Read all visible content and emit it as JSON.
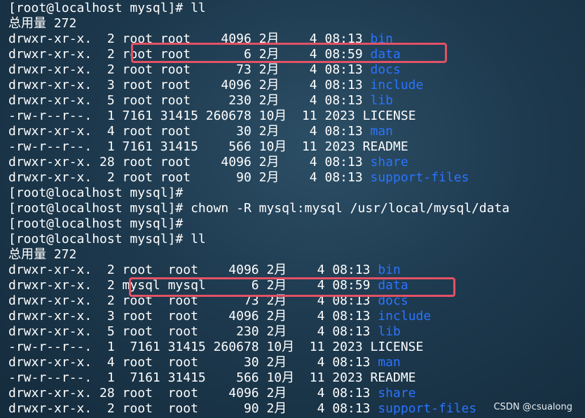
{
  "colors": {
    "directory": "#2a74ff",
    "text": "#ffffff",
    "highlight": "#e25264"
  },
  "block1": {
    "prompt": "[root@localhost mysql]# ll",
    "total": "总用量 272",
    "rows": [
      {
        "prefix": "drwxr-xr-x.  2 root root    4096 2月    4 08:13 ",
        "name": "bin",
        "is_dir": true
      },
      {
        "prefix": "drwxr-xr-x.  2 root root       6 2月    4 08:59 ",
        "name": "data",
        "is_dir": true,
        "highlighted": true
      },
      {
        "prefix": "drwxr-xr-x.  2 root root      73 2月    4 08:13 ",
        "name": "docs",
        "is_dir": true
      },
      {
        "prefix": "drwxr-xr-x.  3 root root    4096 2月    4 08:13 ",
        "name": "include",
        "is_dir": true
      },
      {
        "prefix": "drwxr-xr-x.  5 root root     230 2月    4 08:13 ",
        "name": "lib",
        "is_dir": true
      },
      {
        "prefix": "-rw-r--r--.  1 7161 31415 260678 10月  11 2023 ",
        "name": "LICENSE",
        "is_dir": false
      },
      {
        "prefix": "drwxr-xr-x.  4 root root      30 2月    4 08:13 ",
        "name": "man",
        "is_dir": true
      },
      {
        "prefix": "-rw-r--r--.  1 7161 31415    566 10月  11 2023 ",
        "name": "README",
        "is_dir": false
      },
      {
        "prefix": "drwxr-xr-x. 28 root root    4096 2月    4 08:13 ",
        "name": "share",
        "is_dir": true
      },
      {
        "prefix": "drwxr-xr-x.  2 root root      90 2月    4 08:13 ",
        "name": "support-files",
        "is_dir": true
      }
    ]
  },
  "middle_prompts": [
    "[root@localhost mysql]#",
    "[root@localhost mysql]# chown -R mysql:mysql /usr/local/mysql/data",
    "[root@localhost mysql]#"
  ],
  "block2": {
    "prompt": "[root@localhost mysql]# ll",
    "total": "总用量 272",
    "rows": [
      {
        "prefix": "drwxr-xr-x.  2 root  root    4096 2月    4 08:13 ",
        "name": "bin",
        "is_dir": true
      },
      {
        "prefix": "drwxr-xr-x.  2 mysql mysql      6 2月    4 08:59 ",
        "name": "data",
        "is_dir": true,
        "highlighted": true
      },
      {
        "prefix": "drwxr-xr-x.  2 root  root      73 2月    4 08:13 ",
        "name": "docs",
        "is_dir": true
      },
      {
        "prefix": "drwxr-xr-x.  3 root  root    4096 2月    4 08:13 ",
        "name": "include",
        "is_dir": true
      },
      {
        "prefix": "drwxr-xr-x.  5 root  root     230 2月    4 08:13 ",
        "name": "lib",
        "is_dir": true
      },
      {
        "prefix": "-rw-r--r--.  1  7161 31415 260678 10月  11 2023 ",
        "name": "LICENSE",
        "is_dir": false
      },
      {
        "prefix": "drwxr-xr-x.  4 root  root      30 2月    4 08:13 ",
        "name": "man",
        "is_dir": true
      },
      {
        "prefix": "-rw-r--r--.  1  7161 31415    566 10月  11 2023 ",
        "name": "README",
        "is_dir": false
      },
      {
        "prefix": "drwxr-xr-x. 28 root  root    4096 2月    4 08:13 ",
        "name": "share",
        "is_dir": true
      },
      {
        "prefix": "drwxr-xr-x.  2 root  root      90 2月    4 08:13 ",
        "name": "support-files",
        "is_dir": true
      }
    ]
  },
  "watermark": "CSDN @csualong"
}
